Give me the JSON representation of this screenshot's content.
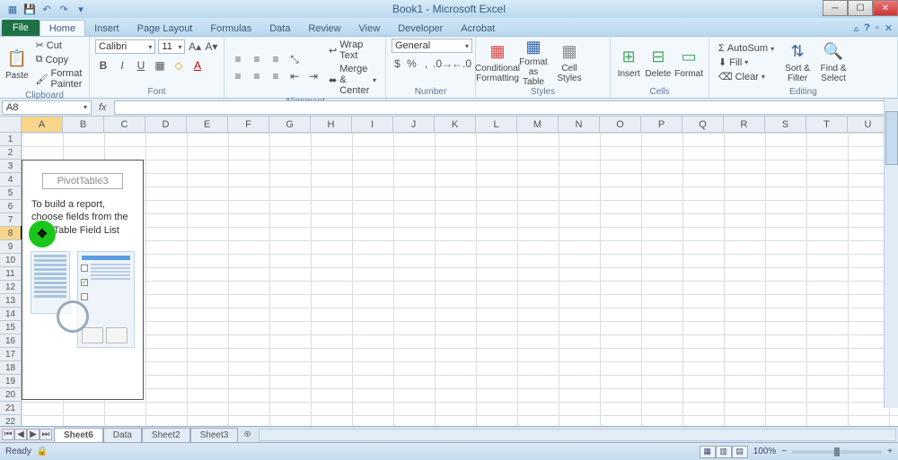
{
  "title": "Book1 - Microsoft Excel",
  "qat": {
    "save": "💾",
    "undo": "↶",
    "redo": "↷"
  },
  "tabs": [
    "File",
    "Home",
    "Insert",
    "Page Layout",
    "Formulas",
    "Data",
    "Review",
    "View",
    "Developer",
    "Acrobat"
  ],
  "active_tab": 1,
  "ribbon": {
    "clipboard": {
      "label": "Clipboard",
      "paste": "Paste",
      "cut": "Cut",
      "copy": "Copy",
      "format_painter": "Format Painter"
    },
    "font": {
      "label": "Font",
      "name": "Calibri",
      "size": "11"
    },
    "alignment": {
      "label": "Alignment",
      "wrap": "Wrap Text",
      "merge": "Merge & Center"
    },
    "number": {
      "label": "Number",
      "format": "General"
    },
    "styles": {
      "label": "Styles",
      "cf": "Conditional Formatting",
      "fat": "Format as Table",
      "cs": "Cell Styles"
    },
    "cells": {
      "label": "Cells",
      "insert": "Insert",
      "delete": "Delete",
      "format": "Format"
    },
    "editing": {
      "label": "Editing",
      "autosum": "AutoSum",
      "fill": "Fill",
      "clear": "Clear",
      "sort": "Sort & Filter",
      "find": "Find & Select"
    }
  },
  "namebox": "A8",
  "columns": [
    "A",
    "B",
    "C",
    "D",
    "E",
    "F",
    "G",
    "H",
    "I",
    "J",
    "K",
    "L",
    "M",
    "N",
    "O",
    "P",
    "Q",
    "R",
    "S",
    "T",
    "U"
  ],
  "rows": 22,
  "selected_col": 0,
  "selected_row": 8,
  "pivot": {
    "name": "PivotTable3",
    "hint": "To build a report, choose fields from the PivotTable Field List"
  },
  "sheets": [
    "Sheet6",
    "Data",
    "Sheet2",
    "Sheet3"
  ],
  "active_sheet": 0,
  "status": {
    "ready": "Ready",
    "zoom": "100%"
  }
}
